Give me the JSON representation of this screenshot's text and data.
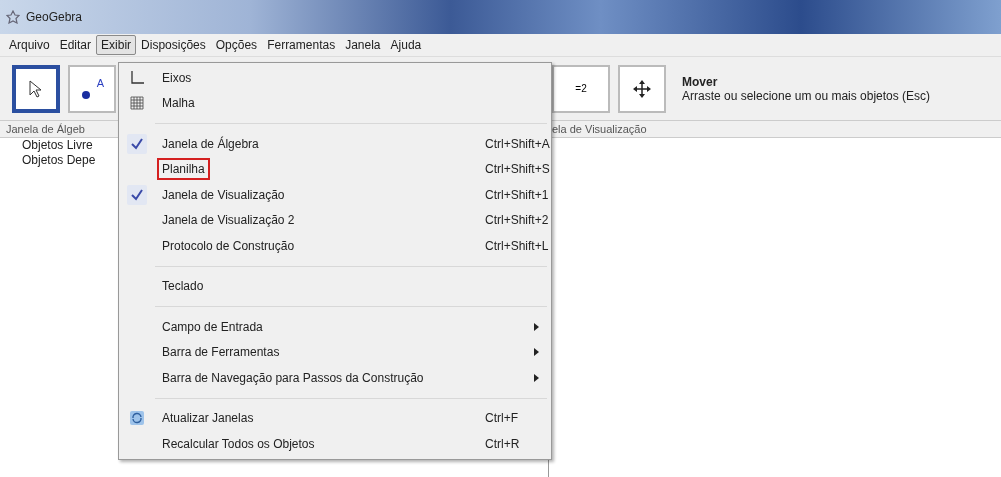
{
  "window": {
    "title": "GeoGebra"
  },
  "menubar": [
    {
      "label": "Arquivo",
      "selected": false
    },
    {
      "label": "Editar",
      "selected": false
    },
    {
      "label": "Exibir",
      "selected": true
    },
    {
      "label": "Disposições",
      "selected": false
    },
    {
      "label": "Opções",
      "selected": false
    },
    {
      "label": "Ferramentas",
      "selected": false
    },
    {
      "label": "Janela",
      "selected": false
    },
    {
      "label": "Ajuda",
      "selected": false
    }
  ],
  "toolbar": {
    "tools": [
      {
        "kind": "move-arrow",
        "selected": true
      },
      {
        "kind": "point",
        "label": "A",
        "selected": false
      }
    ],
    "right_tools": [
      {
        "kind": "equation",
        "label": "=2",
        "selected": false
      },
      {
        "kind": "move-cross",
        "selected": false
      }
    ],
    "tool_name": "Mover",
    "tool_help": "Arraste ou selecione um ou mais objetos (Esc)"
  },
  "algebra_view": {
    "title": "Janela de Álgeb",
    "items": [
      "Objetos Livre",
      "Objetos Depe"
    ]
  },
  "graphics_view": {
    "title": "ela de Visualização"
  },
  "menu": {
    "groups": [
      [
        {
          "kind": "axes",
          "label": "Eixos",
          "marked": false
        },
        {
          "kind": "grid",
          "label": "Malha",
          "marked": false
        }
      ],
      [
        {
          "kind": "check",
          "label": "Janela de Álgebra",
          "shortcut": "Ctrl+Shift+A",
          "checked": true,
          "marked": false
        },
        {
          "kind": "check",
          "label": "Planilha",
          "shortcut": "Ctrl+Shift+S",
          "checked": false,
          "marked": true
        },
        {
          "kind": "check",
          "label": "Janela de Visualização",
          "shortcut": "Ctrl+Shift+1",
          "checked": true,
          "marked": false
        },
        {
          "kind": "check",
          "label": "Janela de Visualização 2",
          "shortcut": "Ctrl+Shift+2",
          "checked": false,
          "marked": false
        },
        {
          "kind": "check",
          "label": "Protocolo de Construção",
          "shortcut": "Ctrl+Shift+L",
          "checked": false,
          "marked": false
        }
      ],
      [
        {
          "kind": "plain",
          "label": "Teclado",
          "marked": false
        }
      ],
      [
        {
          "kind": "submenu",
          "label": "Campo de Entrada",
          "marked": false
        },
        {
          "kind": "submenu",
          "label": "Barra de Ferramentas",
          "marked": false
        },
        {
          "kind": "submenu",
          "label": "Barra de Navegação para Passos da Construção",
          "marked": false
        }
      ],
      [
        {
          "kind": "refresh",
          "label": "Atualizar Janelas",
          "shortcut": "Ctrl+F",
          "marked": false
        },
        {
          "kind": "plain",
          "label": "Recalcular Todos os Objetos",
          "shortcut": "Ctrl+R",
          "marked": false
        }
      ]
    ]
  }
}
